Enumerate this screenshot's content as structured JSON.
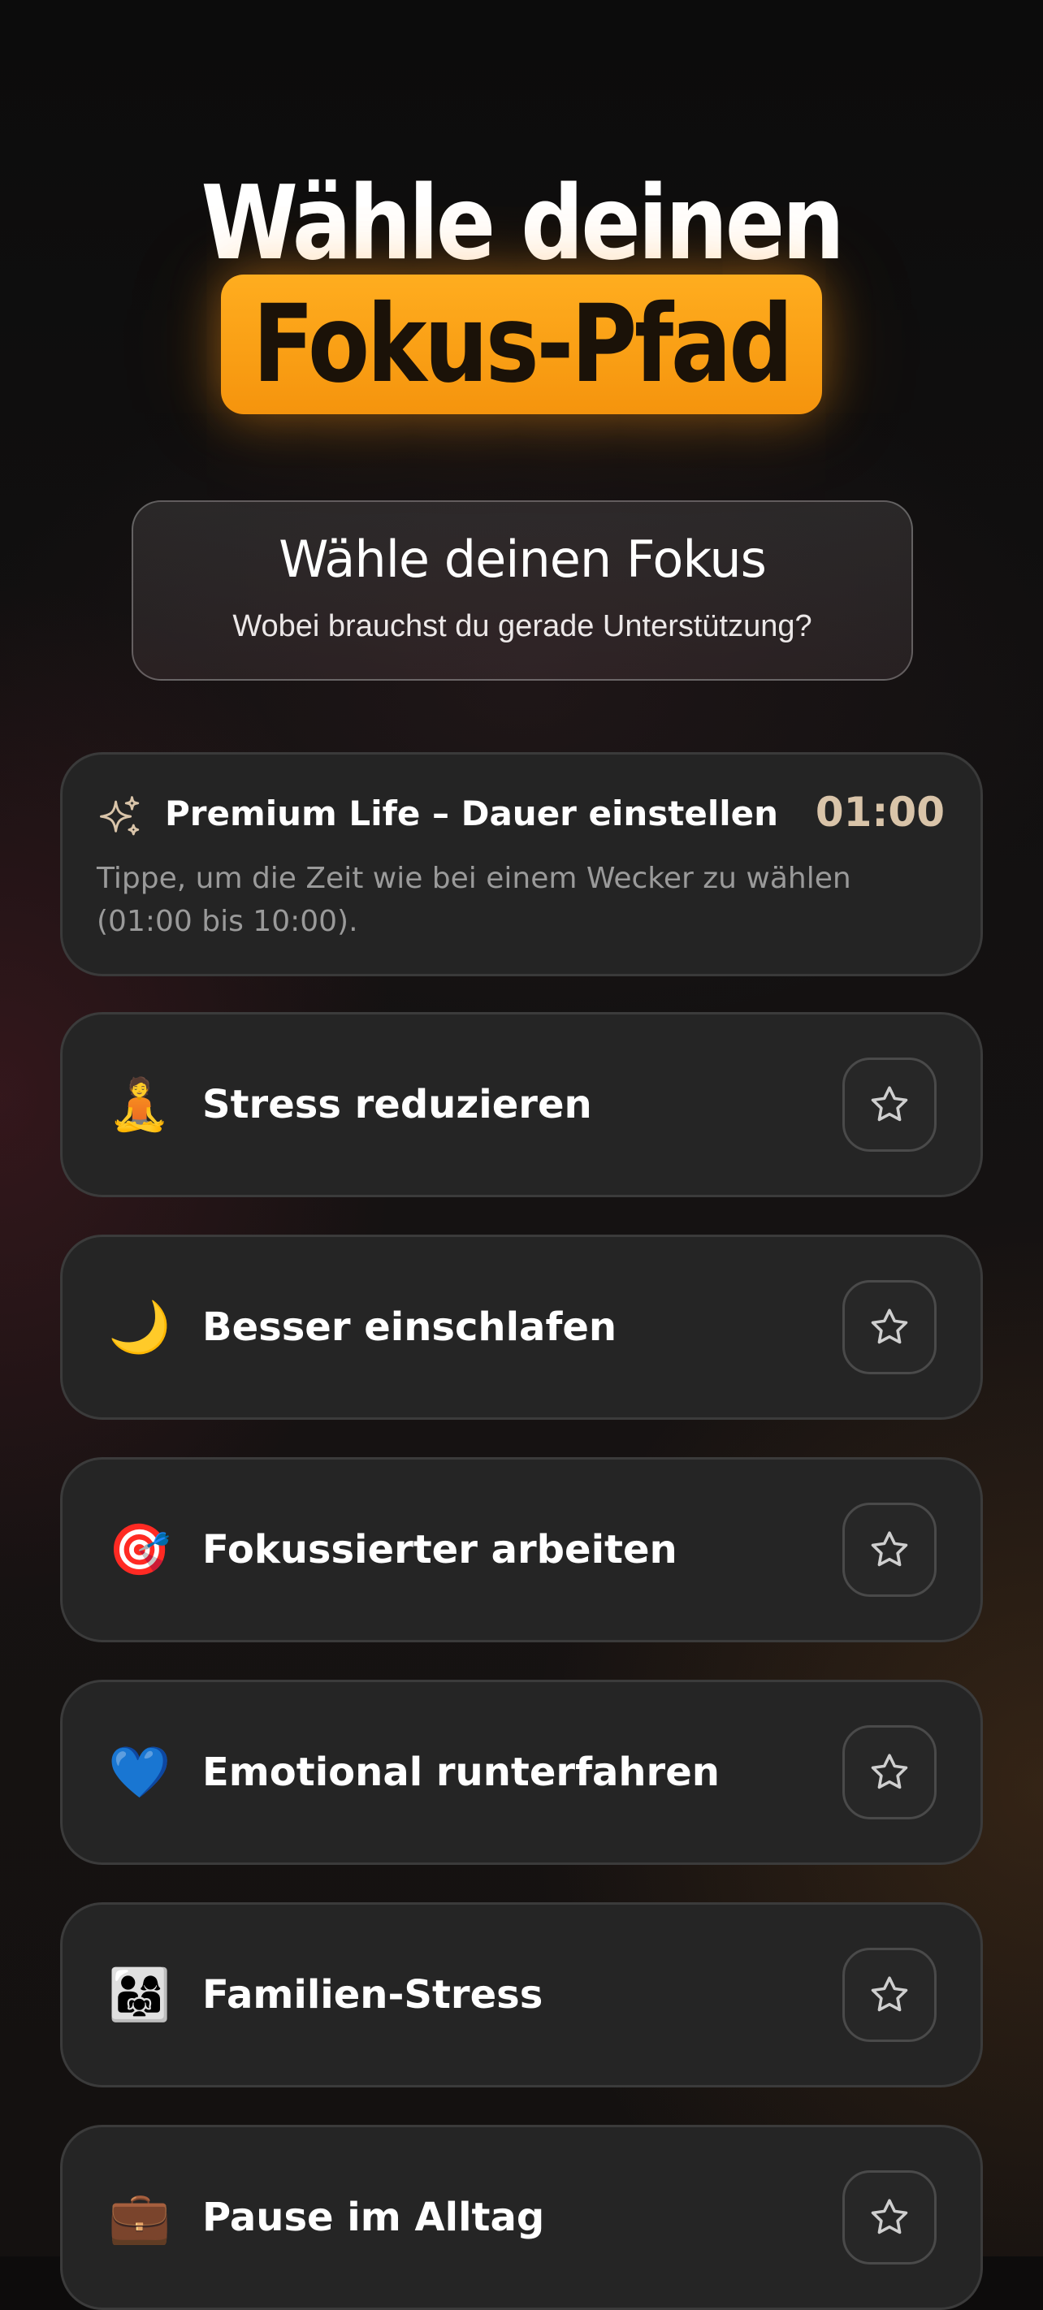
{
  "header": {
    "title_line1": "Wähle deinen",
    "title_line2": "Fokus-Pfad",
    "accent_color": "#f7a014"
  },
  "focus_prompt": {
    "title": "Wähle deinen Fokus",
    "subtitle": "Wobei brauchst du gerade Unterstützung?"
  },
  "premium": {
    "icon": "sparkle-icon",
    "title": "Premium Life – Dauer einstellen",
    "time": "01:00",
    "description": "Tippe, um die Zeit wie bei einem Wecker zu wählen (01:00 bis 10:00).",
    "time_color": "#d9c4a9"
  },
  "options": [
    {
      "emoji": "🧘",
      "icon": "meditation-icon",
      "label": "Stress reduzieren"
    },
    {
      "emoji": "🌙",
      "icon": "crescent-moon-icon",
      "label": "Besser einschlafen"
    },
    {
      "emoji": "🎯",
      "icon": "target-icon",
      "label": "Fokussierter arbeiten"
    },
    {
      "emoji": "💙",
      "icon": "blue-heart-icon",
      "label": "Emotional runterfahren"
    },
    {
      "emoji": "👨‍👩‍👧",
      "icon": "family-icon",
      "label": "Familien-Stress"
    },
    {
      "emoji": "💼",
      "icon": "briefcase-icon",
      "label": "Pause im Alltag"
    }
  ],
  "favorite_icon": "star-outline-icon"
}
